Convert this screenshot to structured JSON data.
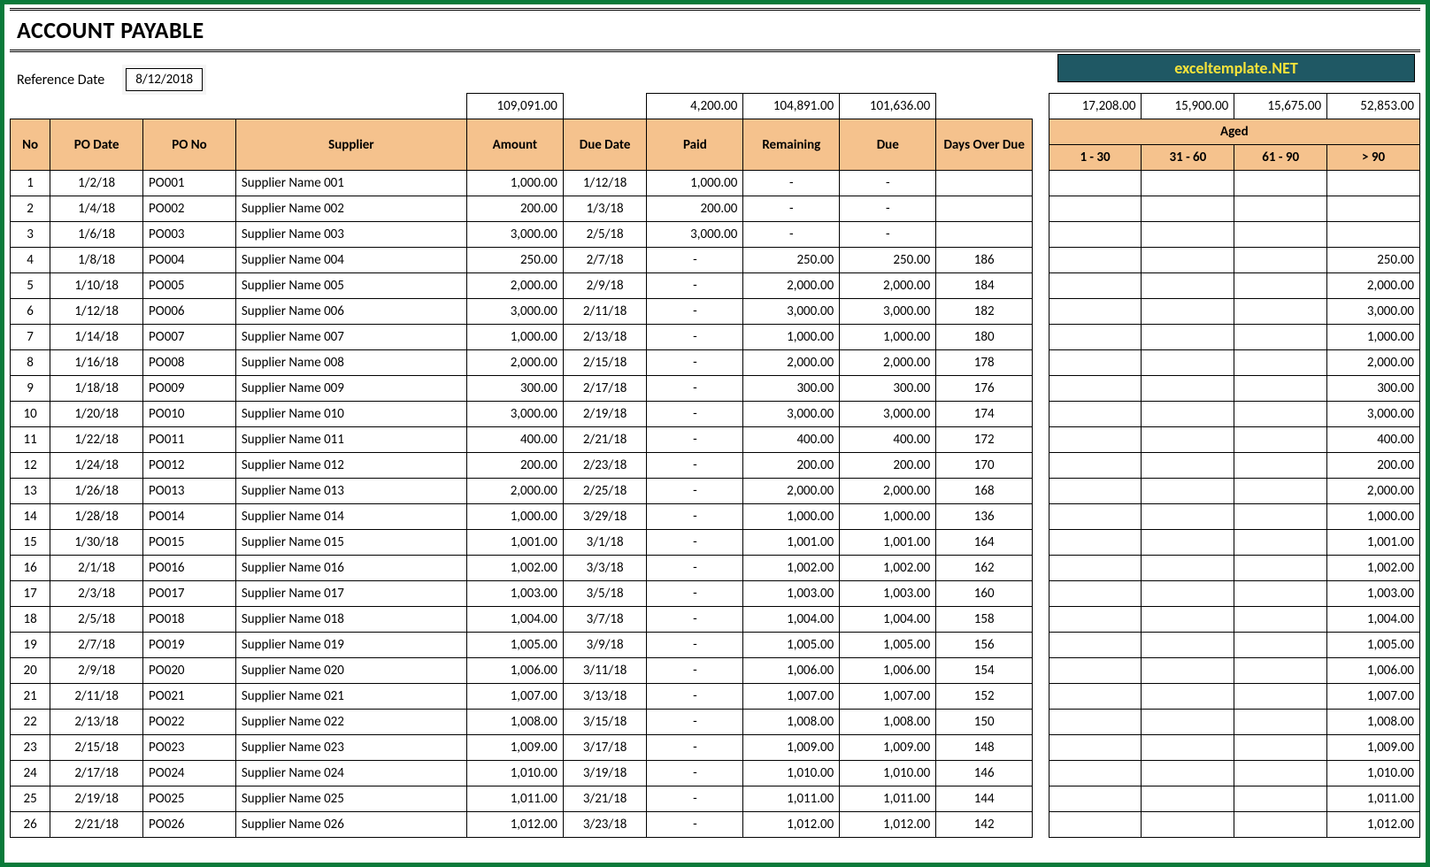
{
  "title": "ACCOUNT PAYABLE",
  "reference_label": "Reference Date",
  "reference_date": "8/12/2018",
  "brand": "exceltemplate.NET",
  "summary": {
    "amount": "109,091.00",
    "paid": "4,200.00",
    "remaining": "104,891.00",
    "due": "101,636.00",
    "aged_1_30": "17,208.00",
    "aged_31_60": "15,900.00",
    "aged_61_90": "15,675.00",
    "aged_over90": "52,853.00"
  },
  "headers": {
    "no": "No",
    "po_date": "PO Date",
    "po_no": "PO No",
    "supplier": "Supplier",
    "amount": "Amount",
    "due_date": "Due Date",
    "paid": "Paid",
    "remaining": "Remaining",
    "due": "Due",
    "days_over_due": "Days Over Due",
    "aged": "Aged",
    "a1": "1 - 30",
    "a2": "31 - 60",
    "a3": "61 - 90",
    "a4": "> 90"
  },
  "rows": [
    {
      "no": "1",
      "po_date": "1/2/18",
      "po_no": "PO001",
      "supplier": "Supplier Name 001",
      "amount": "1,000.00",
      "due_date": "1/12/18",
      "paid": "1,000.00",
      "remaining": "-",
      "due": "-",
      "days": "",
      "a1": "",
      "a2": "",
      "a3": "",
      "a4": ""
    },
    {
      "no": "2",
      "po_date": "1/4/18",
      "po_no": "PO002",
      "supplier": "Supplier Name 002",
      "amount": "200.00",
      "due_date": "1/3/18",
      "paid": "200.00",
      "remaining": "-",
      "due": "-",
      "days": "",
      "a1": "",
      "a2": "",
      "a3": "",
      "a4": ""
    },
    {
      "no": "3",
      "po_date": "1/6/18",
      "po_no": "PO003",
      "supplier": "Supplier Name 003",
      "amount": "3,000.00",
      "due_date": "2/5/18",
      "paid": "3,000.00",
      "remaining": "-",
      "due": "-",
      "days": "",
      "a1": "",
      "a2": "",
      "a3": "",
      "a4": ""
    },
    {
      "no": "4",
      "po_date": "1/8/18",
      "po_no": "PO004",
      "supplier": "Supplier Name 004",
      "amount": "250.00",
      "due_date": "2/7/18",
      "paid": "-",
      "remaining": "250.00",
      "due": "250.00",
      "days": "186",
      "a1": "",
      "a2": "",
      "a3": "",
      "a4": "250.00"
    },
    {
      "no": "5",
      "po_date": "1/10/18",
      "po_no": "PO005",
      "supplier": "Supplier Name 005",
      "amount": "2,000.00",
      "due_date": "2/9/18",
      "paid": "-",
      "remaining": "2,000.00",
      "due": "2,000.00",
      "days": "184",
      "a1": "",
      "a2": "",
      "a3": "",
      "a4": "2,000.00"
    },
    {
      "no": "6",
      "po_date": "1/12/18",
      "po_no": "PO006",
      "supplier": "Supplier Name 006",
      "amount": "3,000.00",
      "due_date": "2/11/18",
      "paid": "-",
      "remaining": "3,000.00",
      "due": "3,000.00",
      "days": "182",
      "a1": "",
      "a2": "",
      "a3": "",
      "a4": "3,000.00"
    },
    {
      "no": "7",
      "po_date": "1/14/18",
      "po_no": "PO007",
      "supplier": "Supplier Name 007",
      "amount": "1,000.00",
      "due_date": "2/13/18",
      "paid": "-",
      "remaining": "1,000.00",
      "due": "1,000.00",
      "days": "180",
      "a1": "",
      "a2": "",
      "a3": "",
      "a4": "1,000.00"
    },
    {
      "no": "8",
      "po_date": "1/16/18",
      "po_no": "PO008",
      "supplier": "Supplier Name 008",
      "amount": "2,000.00",
      "due_date": "2/15/18",
      "paid": "-",
      "remaining": "2,000.00",
      "due": "2,000.00",
      "days": "178",
      "a1": "",
      "a2": "",
      "a3": "",
      "a4": "2,000.00"
    },
    {
      "no": "9",
      "po_date": "1/18/18",
      "po_no": "PO009",
      "supplier": "Supplier Name 009",
      "amount": "300.00",
      "due_date": "2/17/18",
      "paid": "-",
      "remaining": "300.00",
      "due": "300.00",
      "days": "176",
      "a1": "",
      "a2": "",
      "a3": "",
      "a4": "300.00"
    },
    {
      "no": "10",
      "po_date": "1/20/18",
      "po_no": "PO010",
      "supplier": "Supplier Name 010",
      "amount": "3,000.00",
      "due_date": "2/19/18",
      "paid": "-",
      "remaining": "3,000.00",
      "due": "3,000.00",
      "days": "174",
      "a1": "",
      "a2": "",
      "a3": "",
      "a4": "3,000.00"
    },
    {
      "no": "11",
      "po_date": "1/22/18",
      "po_no": "PO011",
      "supplier": "Supplier Name 011",
      "amount": "400.00",
      "due_date": "2/21/18",
      "paid": "-",
      "remaining": "400.00",
      "due": "400.00",
      "days": "172",
      "a1": "",
      "a2": "",
      "a3": "",
      "a4": "400.00"
    },
    {
      "no": "12",
      "po_date": "1/24/18",
      "po_no": "PO012",
      "supplier": "Supplier Name 012",
      "amount": "200.00",
      "due_date": "2/23/18",
      "paid": "-",
      "remaining": "200.00",
      "due": "200.00",
      "days": "170",
      "a1": "",
      "a2": "",
      "a3": "",
      "a4": "200.00"
    },
    {
      "no": "13",
      "po_date": "1/26/18",
      "po_no": "PO013",
      "supplier": "Supplier Name 013",
      "amount": "2,000.00",
      "due_date": "2/25/18",
      "paid": "-",
      "remaining": "2,000.00",
      "due": "2,000.00",
      "days": "168",
      "a1": "",
      "a2": "",
      "a3": "",
      "a4": "2,000.00"
    },
    {
      "no": "14",
      "po_date": "1/28/18",
      "po_no": "PO014",
      "supplier": "Supplier Name 014",
      "amount": "1,000.00",
      "due_date": "3/29/18",
      "paid": "-",
      "remaining": "1,000.00",
      "due": "1,000.00",
      "days": "136",
      "a1": "",
      "a2": "",
      "a3": "",
      "a4": "1,000.00"
    },
    {
      "no": "15",
      "po_date": "1/30/18",
      "po_no": "PO015",
      "supplier": "Supplier Name 015",
      "amount": "1,001.00",
      "due_date": "3/1/18",
      "paid": "-",
      "remaining": "1,001.00",
      "due": "1,001.00",
      "days": "164",
      "a1": "",
      "a2": "",
      "a3": "",
      "a4": "1,001.00"
    },
    {
      "no": "16",
      "po_date": "2/1/18",
      "po_no": "PO016",
      "supplier": "Supplier Name 016",
      "amount": "1,002.00",
      "due_date": "3/3/18",
      "paid": "-",
      "remaining": "1,002.00",
      "due": "1,002.00",
      "days": "162",
      "a1": "",
      "a2": "",
      "a3": "",
      "a4": "1,002.00"
    },
    {
      "no": "17",
      "po_date": "2/3/18",
      "po_no": "PO017",
      "supplier": "Supplier Name 017",
      "amount": "1,003.00",
      "due_date": "3/5/18",
      "paid": "-",
      "remaining": "1,003.00",
      "due": "1,003.00",
      "days": "160",
      "a1": "",
      "a2": "",
      "a3": "",
      "a4": "1,003.00"
    },
    {
      "no": "18",
      "po_date": "2/5/18",
      "po_no": "PO018",
      "supplier": "Supplier Name 018",
      "amount": "1,004.00",
      "due_date": "3/7/18",
      "paid": "-",
      "remaining": "1,004.00",
      "due": "1,004.00",
      "days": "158",
      "a1": "",
      "a2": "",
      "a3": "",
      "a4": "1,004.00"
    },
    {
      "no": "19",
      "po_date": "2/7/18",
      "po_no": "PO019",
      "supplier": "Supplier Name 019",
      "amount": "1,005.00",
      "due_date": "3/9/18",
      "paid": "-",
      "remaining": "1,005.00",
      "due": "1,005.00",
      "days": "156",
      "a1": "",
      "a2": "",
      "a3": "",
      "a4": "1,005.00"
    },
    {
      "no": "20",
      "po_date": "2/9/18",
      "po_no": "PO020",
      "supplier": "Supplier Name 020",
      "amount": "1,006.00",
      "due_date": "3/11/18",
      "paid": "-",
      "remaining": "1,006.00",
      "due": "1,006.00",
      "days": "154",
      "a1": "",
      "a2": "",
      "a3": "",
      "a4": "1,006.00"
    },
    {
      "no": "21",
      "po_date": "2/11/18",
      "po_no": "PO021",
      "supplier": "Supplier Name 021",
      "amount": "1,007.00",
      "due_date": "3/13/18",
      "paid": "-",
      "remaining": "1,007.00",
      "due": "1,007.00",
      "days": "152",
      "a1": "",
      "a2": "",
      "a3": "",
      "a4": "1,007.00"
    },
    {
      "no": "22",
      "po_date": "2/13/18",
      "po_no": "PO022",
      "supplier": "Supplier Name 022",
      "amount": "1,008.00",
      "due_date": "3/15/18",
      "paid": "-",
      "remaining": "1,008.00",
      "due": "1,008.00",
      "days": "150",
      "a1": "",
      "a2": "",
      "a3": "",
      "a4": "1,008.00"
    },
    {
      "no": "23",
      "po_date": "2/15/18",
      "po_no": "PO023",
      "supplier": "Supplier Name 023",
      "amount": "1,009.00",
      "due_date": "3/17/18",
      "paid": "-",
      "remaining": "1,009.00",
      "due": "1,009.00",
      "days": "148",
      "a1": "",
      "a2": "",
      "a3": "",
      "a4": "1,009.00"
    },
    {
      "no": "24",
      "po_date": "2/17/18",
      "po_no": "PO024",
      "supplier": "Supplier Name 024",
      "amount": "1,010.00",
      "due_date": "3/19/18",
      "paid": "-",
      "remaining": "1,010.00",
      "due": "1,010.00",
      "days": "146",
      "a1": "",
      "a2": "",
      "a3": "",
      "a4": "1,010.00"
    },
    {
      "no": "25",
      "po_date": "2/19/18",
      "po_no": "PO025",
      "supplier": "Supplier Name 025",
      "amount": "1,011.00",
      "due_date": "3/21/18",
      "paid": "-",
      "remaining": "1,011.00",
      "due": "1,011.00",
      "days": "144",
      "a1": "",
      "a2": "",
      "a3": "",
      "a4": "1,011.00"
    },
    {
      "no": "26",
      "po_date": "2/21/18",
      "po_no": "PO026",
      "supplier": "Supplier Name 026",
      "amount": "1,012.00",
      "due_date": "3/23/18",
      "paid": "-",
      "remaining": "1,012.00",
      "due": "1,012.00",
      "days": "142",
      "a1": "",
      "a2": "",
      "a3": "",
      "a4": "1,012.00"
    }
  ]
}
